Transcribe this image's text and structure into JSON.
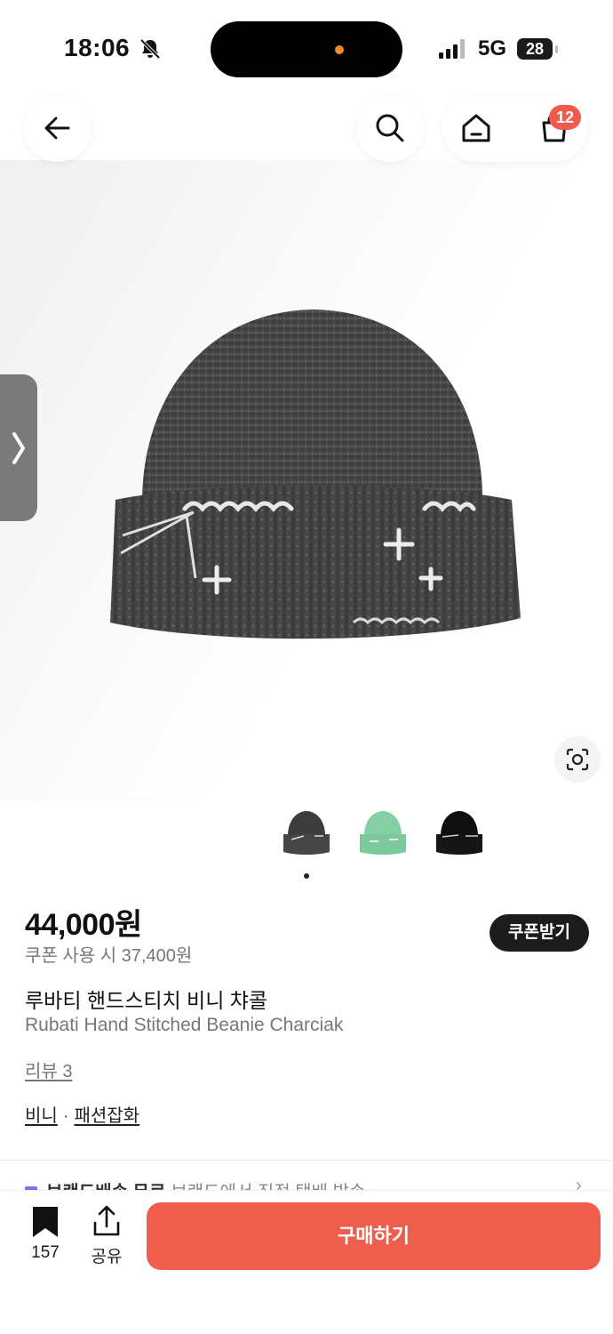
{
  "status_bar": {
    "time": "18:06",
    "network": "5G",
    "battery": "28"
  },
  "header": {
    "icons": [
      "back-arrow-icon",
      "search-icon",
      "home-icon",
      "cart-icon"
    ],
    "cart_badge": "12"
  },
  "gallery": {
    "thumbnails": [
      {
        "name": "charcoal",
        "color": "#3a3a3a"
      },
      {
        "name": "mint",
        "color": "#7fcfa0"
      },
      {
        "name": "black",
        "color": "#0d0d0d"
      }
    ]
  },
  "product": {
    "price": "44,000원",
    "coupon_price": "쿠폰 사용 시 37,400원",
    "coupon_button": "쿠폰받기",
    "name_ko": "루바티 핸드스티치 비니 챠콜",
    "name_en": "Rubati Hand Stitched Beanie Charciak",
    "review_link": "리뷰 3",
    "categories": [
      "비니",
      "패션잡화"
    ],
    "separator": "·"
  },
  "shipping_peek": {
    "title": "브랜드배송 무료",
    "subtitle": "브랜드에서 직접 택배 발송"
  },
  "bottom_bar": {
    "bookmark_count": "157",
    "share_label": "공유",
    "buy_label": "구매하기"
  },
  "colors": {
    "accent": "#ef5e4d",
    "badge": "#ef5a4c",
    "dark_button": "#1c1c1c"
  }
}
